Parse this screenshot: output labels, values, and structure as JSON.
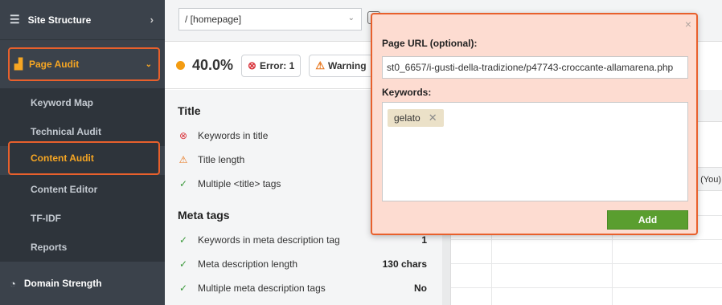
{
  "sidebar": {
    "site_structure": "Site Structure",
    "page_audit": "Page Audit",
    "items": [
      {
        "label": "Keyword Map"
      },
      {
        "label": "Technical Audit"
      },
      {
        "label": "Content Audit"
      },
      {
        "label": "Content Editor"
      },
      {
        "label": "TF-IDF"
      },
      {
        "label": "Reports"
      }
    ],
    "domain_strength": "Domain Strength"
  },
  "topbar": {
    "url_value": "/ [homepage]"
  },
  "score": {
    "percent": "40.0%",
    "error_label": "Error: 1",
    "warning_label": "Warning"
  },
  "sections": {
    "title": {
      "heading": "Title",
      "rows": [
        {
          "label": "Keywords in title",
          "status": "error"
        },
        {
          "label": "Title length",
          "status": "warning"
        },
        {
          "label": "Multiple <title> tags",
          "status": "ok"
        }
      ]
    },
    "meta": {
      "heading": "Meta tags",
      "rows": [
        {
          "label": "Keywords in meta description tag",
          "status": "ok",
          "value": "1"
        },
        {
          "label": "Meta description length",
          "status": "ok",
          "value": "130 chars"
        },
        {
          "label": "Multiple meta description tags",
          "status": "ok",
          "value": "No"
        }
      ]
    }
  },
  "right_panel": {
    "column_label": "(You)"
  },
  "modal": {
    "url_label": "Page URL (optional):",
    "url_value": "st0_6657/i-gusti-della-tradizione/p47743-croccante-allamarena.php",
    "keywords_label": "Keywords:",
    "keywords": [
      "gelato"
    ],
    "add_label": "Add",
    "close_glyph": "×"
  },
  "colors": {
    "accent": "#e8602c",
    "active_text": "#f6a623",
    "add_button": "#5a9e2f",
    "modal_bg": "#fddcd1"
  }
}
